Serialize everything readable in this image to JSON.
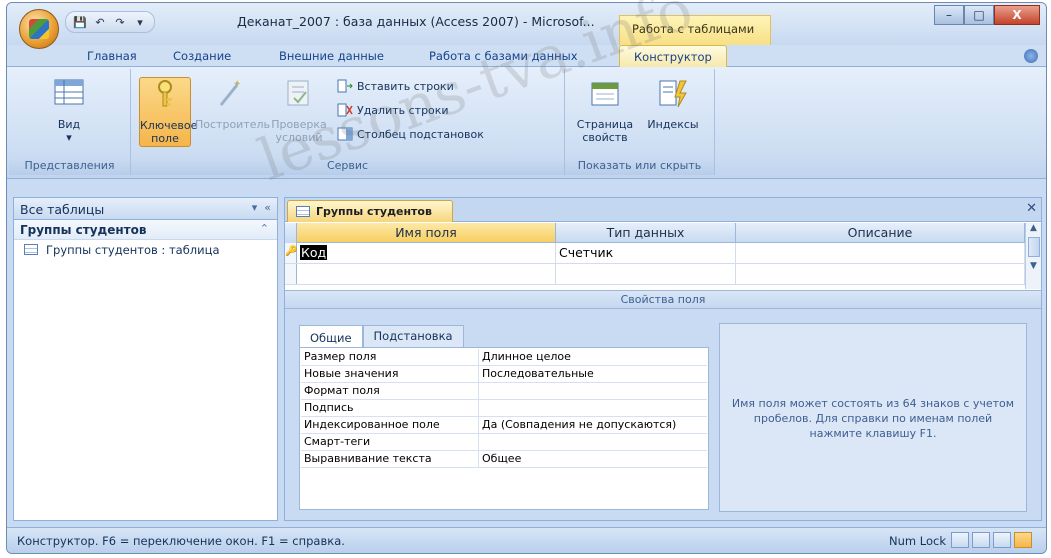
{
  "window": {
    "title": "Деканат_2007 : база данных (Access 2007) - Microsof...",
    "context_tab_title": "Работа с таблицами",
    "controls": [
      "–",
      "□",
      "X"
    ]
  },
  "ribbon_tabs": [
    "Главная",
    "Создание",
    "Внешние данные",
    "Работа с базами данных",
    "Конструктор"
  ],
  "ribbon": {
    "groups": {
      "views": "Представления",
      "service": "Сервис",
      "show_hide": "Показать или скрыть"
    },
    "buttons": {
      "view": "Вид",
      "primary_key_1": "Ключевое",
      "primary_key_2": "поле",
      "builder": "Построитель",
      "check_1": "Проверка",
      "check_2": "условий",
      "insert_rows": "Вставить строки",
      "delete_rows": "Удалить строки",
      "lookup_column": "Столбец подстановок",
      "property_sheet_1": "Страница",
      "property_sheet_2": "свойств",
      "indexes": "Индексы"
    }
  },
  "nav": {
    "header": "Все таблицы",
    "group": "Группы студентов",
    "item": "Группы студентов : таблица"
  },
  "document": {
    "tab": "Группы студентов",
    "columns": [
      "Имя поля",
      "Тип данных",
      "Описание"
    ],
    "rows": [
      {
        "name": "Код",
        "type": "Счетчик",
        "desc": ""
      }
    ],
    "props_title": "Свойства поля",
    "props_tabs": [
      "Общие",
      "Подстановка"
    ],
    "properties": [
      {
        "key": "Размер поля",
        "value": "Длинное целое"
      },
      {
        "key": "Новые значения",
        "value": "Последовательные"
      },
      {
        "key": "Формат поля",
        "value": ""
      },
      {
        "key": "Подпись",
        "value": ""
      },
      {
        "key": "Индексированное поле",
        "value": "Да (Совпадения не допускаются)"
      },
      {
        "key": "Смарт-теги",
        "value": ""
      },
      {
        "key": "Выравнивание текста",
        "value": "Общее"
      }
    ],
    "hint": "Имя поля может состоять из 64 знаков с учетом пробелов. Для справки по именам полей нажмите клавишу F1."
  },
  "status": {
    "text": "Конструктор. F6 = переключение окон. F1 = справка.",
    "numlock": "Num Lock"
  },
  "watermark": "lessons-tva.info",
  "colors": {
    "active_tab": "#f6e8a8",
    "pressed_button": "#f5b54a",
    "frame": "#c9dbf2"
  }
}
